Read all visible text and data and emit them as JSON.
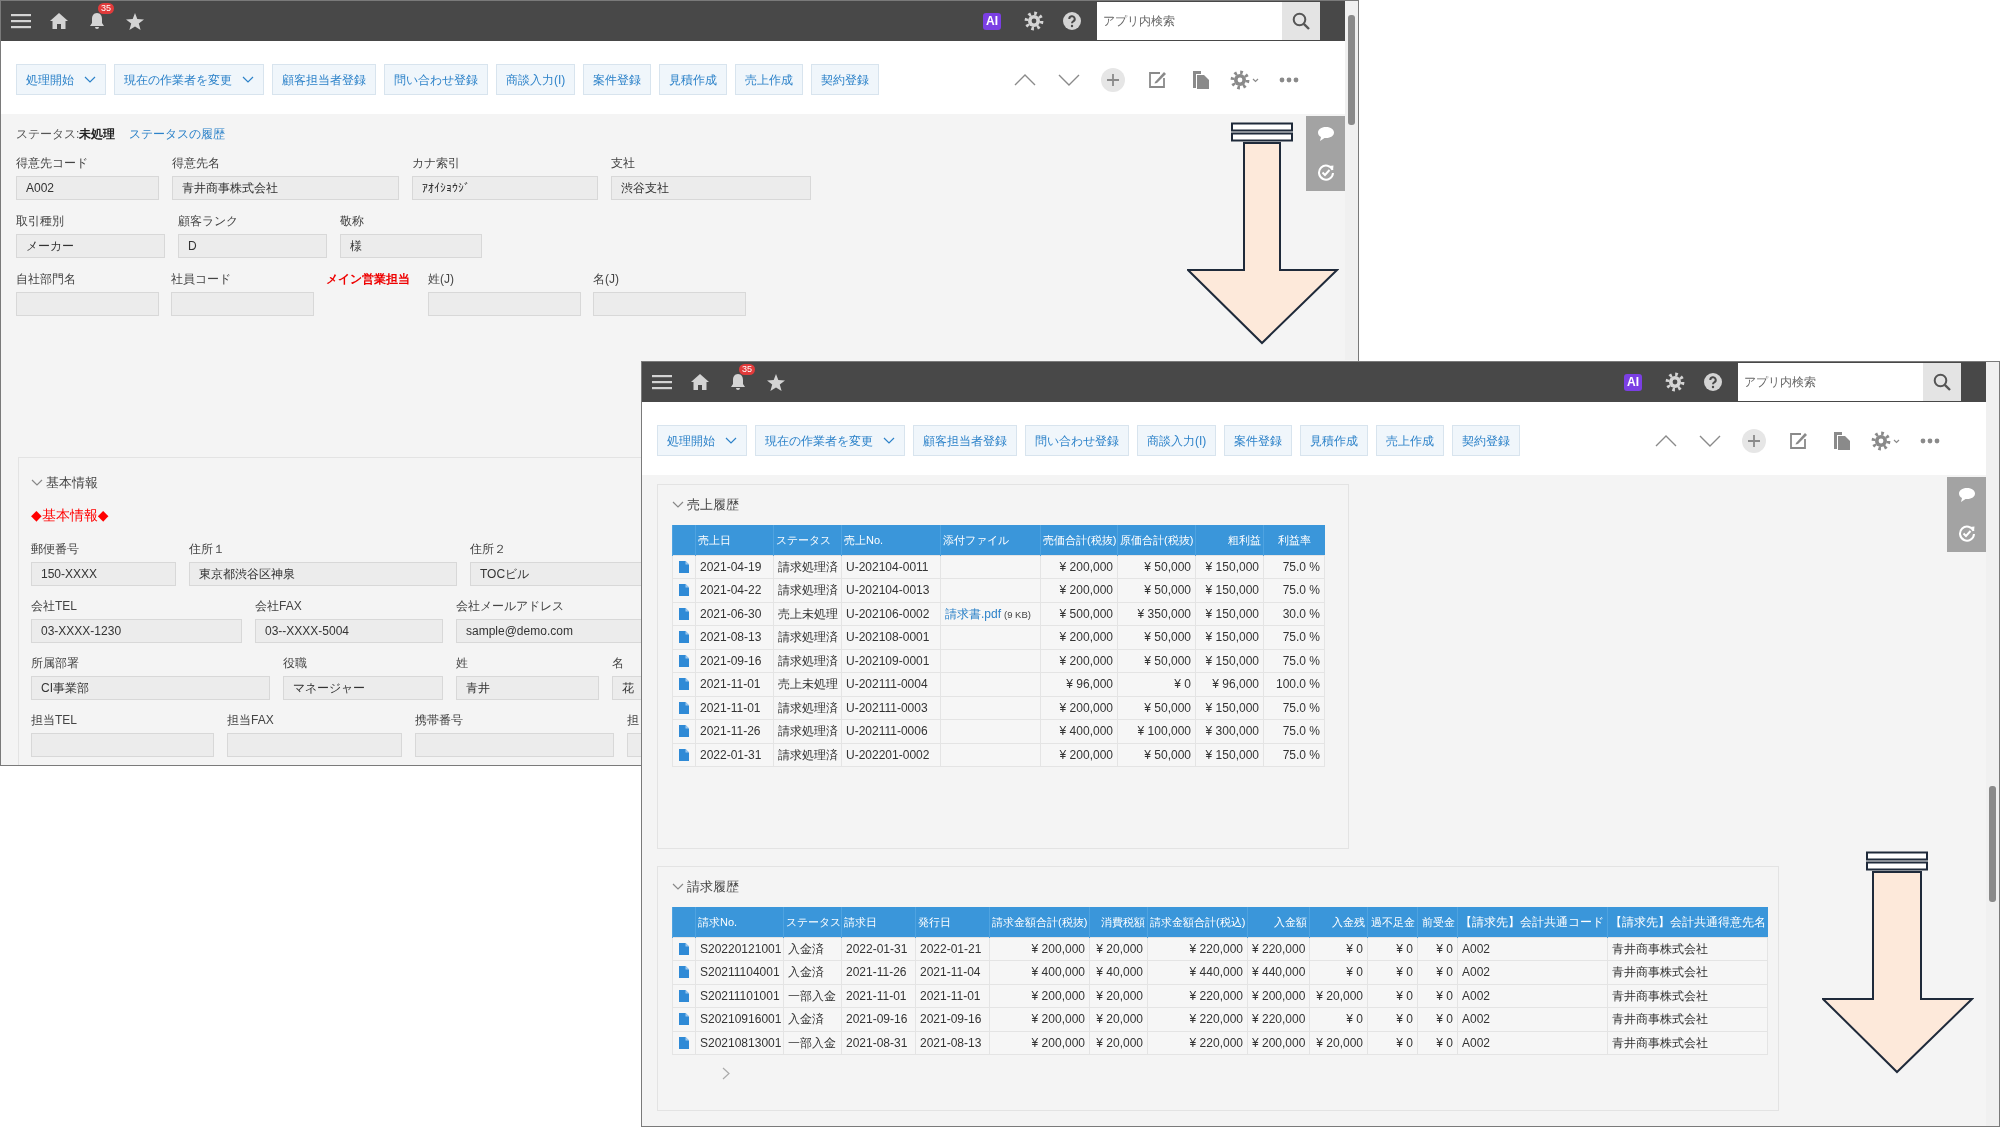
{
  "windows": [
    {
      "toolbar": {
        "notification_count": "35",
        "ai_label": "AI",
        "search_placeholder": "アプリ内検索"
      },
      "actions": [
        {
          "label": "処理開始",
          "dropdown": true
        },
        {
          "label": "現在の作業者を変更",
          "dropdown": true
        },
        {
          "label": "顧客担当者登録",
          "dropdown": false
        },
        {
          "label": "問い合わせ登録",
          "dropdown": false
        },
        {
          "label": "商談入力(I)",
          "dropdown": false
        },
        {
          "label": "案件登録",
          "dropdown": false
        },
        {
          "label": "見積作成",
          "dropdown": false
        },
        {
          "label": "売上作成",
          "dropdown": false
        },
        {
          "label": "契約登録",
          "dropdown": false
        }
      ],
      "status": {
        "label": "ステータス:",
        "value": "未処理",
        "link": "ステータスの履歴"
      },
      "form_rows": [
        [
          {
            "kind": "field",
            "label": "得意先コード",
            "value": "A002"
          },
          {
            "kind": "field",
            "label": "得意先名",
            "value": "青井商事株式会社"
          },
          {
            "kind": "field",
            "label": "カナ索引",
            "value": "ｱｵｲｼｮｳｼﾞ"
          },
          {
            "kind": "field",
            "label": "支社",
            "value": "渋谷支社"
          }
        ],
        [
          {
            "kind": "field",
            "label": "取引種別",
            "value": "メーカー"
          },
          {
            "kind": "field",
            "label": "顧客ランク",
            "value": "D"
          },
          {
            "kind": "field",
            "label": "敬称",
            "value": "様"
          }
        ],
        [
          {
            "kind": "field",
            "label": "自社部門名"
          },
          {
            "kind": "field",
            "label": "社員コード"
          },
          {
            "kind": "heading",
            "label": "メイン営業担当"
          },
          {
            "kind": "field",
            "label": "姓(J)"
          },
          {
            "kind": "field",
            "label": "名(J)"
          }
        ]
      ],
      "section": {
        "title": "基本情報",
        "expanded": true,
        "heading": "◆基本情報◆",
        "rows": [
          [
            {
              "label": "郵便番号",
              "value": "150-XXXX"
            },
            {
              "label": "住所１",
              "value": "東京都渋谷区神泉"
            },
            {
              "label": "住所２",
              "value": "TOCビル"
            }
          ],
          [
            {
              "label": "会社TEL",
              "value": "03-XXXX-1230"
            },
            {
              "label": "会社FAX",
              "value": "03--XXXX-5004"
            },
            {
              "label": "会社メールアドレス",
              "value": "sample@demo.com"
            }
          ],
          [
            {
              "label": "所属部署",
              "value": "CI事業部"
            },
            {
              "label": "役職",
              "value": "マネージャー"
            },
            {
              "label": "姓",
              "value": "青井"
            },
            {
              "label": "名",
              "value": "花"
            }
          ],
          [
            {
              "label": "担当TEL"
            },
            {
              "label": "担当FAX"
            },
            {
              "label": "携帯番号"
            },
            {
              "label": "担"
            }
          ]
        ]
      }
    },
    {
      "toolbar": {
        "notification_count": "35",
        "ai_label": "AI",
        "search_placeholder": "アプリ内検索"
      },
      "actions": [
        {
          "label": "処理開始",
          "dropdown": true
        },
        {
          "label": "現在の作業者を変更",
          "dropdown": true
        },
        {
          "label": "顧客担当者登録",
          "dropdown": false
        },
        {
          "label": "問い合わせ登録",
          "dropdown": false
        },
        {
          "label": "商談入力(I)",
          "dropdown": false
        },
        {
          "label": "案件登録",
          "dropdown": false
        },
        {
          "label": "見積作成",
          "dropdown": false
        },
        {
          "label": "売上作成",
          "dropdown": false
        },
        {
          "label": "契約登録",
          "dropdown": false
        }
      ],
      "sales_history": {
        "title": "売上履歴",
        "expanded": true,
        "columns": [
          "売上日",
          "ステータス",
          "売上No.",
          "添付ファイル",
          "売価合計(税抜)",
          "原価合計(税抜)",
          "粗利益",
          "利益率"
        ],
        "rows": [
          {
            "cells": [
              "2021-04-19",
              "請求処理済",
              "U-202104-0011",
              "",
              "¥ 200,000",
              "¥ 50,000",
              "¥ 150,000",
              "75.0 %"
            ]
          },
          {
            "cells": [
              "2021-04-22",
              "請求処理済",
              "U-202104-0013",
              "",
              "¥ 200,000",
              "¥ 50,000",
              "¥ 150,000",
              "75.0 %"
            ]
          },
          {
            "cells": [
              "2021-06-30",
              "売上未処理",
              "U-202106-0002",
              {
                "file": "請求書.pdf",
                "size": "(9 KB)"
              },
              "¥ 500,000",
              "¥ 350,000",
              "¥ 150,000",
              "30.0 %"
            ]
          },
          {
            "cells": [
              "2021-08-13",
              "請求処理済",
              "U-202108-0001",
              "",
              "¥ 200,000",
              "¥ 50,000",
              "¥ 150,000",
              "75.0 %"
            ]
          },
          {
            "cells": [
              "2021-09-16",
              "請求処理済",
              "U-202109-0001",
              "",
              "¥ 200,000",
              "¥ 50,000",
              "¥ 150,000",
              "75.0 %"
            ]
          },
          {
            "cells": [
              "2021-11-01",
              "売上未処理",
              "U-202111-0004",
              "",
              "¥ 96,000",
              "¥ 0",
              "¥ 96,000",
              "100.0 %"
            ]
          },
          {
            "cells": [
              "2021-11-01",
              "請求処理済",
              "U-202111-0003",
              "",
              "¥ 200,000",
              "¥ 50,000",
              "¥ 150,000",
              "75.0 %"
            ]
          },
          {
            "cells": [
              "2021-11-26",
              "請求処理済",
              "U-202111-0006",
              "",
              "¥ 400,000",
              "¥ 100,000",
              "¥ 300,000",
              "75.0 %"
            ]
          },
          {
            "cells": [
              "2022-01-31",
              "請求処理済",
              "U-202201-0002",
              "",
              "¥ 200,000",
              "¥ 50,000",
              "¥ 150,000",
              "75.0 %"
            ]
          }
        ]
      },
      "billing_history": {
        "title": "請求履歴",
        "expanded": true,
        "columns": [
          "請求No.",
          "ステータス",
          "請求日",
          "発行日",
          "請求金額合計(税抜)",
          "消費税額",
          "請求金額合計(税込)",
          "入金額",
          "入金残",
          "過不足金",
          "前受金",
          "【請求先】会計共通コード",
          "【請求先】会計共通得意先名"
        ],
        "rows": [
          {
            "cells": [
              "S20220121001",
              "入金済",
              "2022-01-31",
              "2022-01-21",
              "¥ 200,000",
              "¥ 20,000",
              "¥ 220,000",
              "¥ 220,000",
              "¥ 0",
              "¥ 0",
              "¥ 0",
              "A002",
              "青井商事株式会社"
            ]
          },
          {
            "cells": [
              "S20211104001",
              "入金済",
              "2021-11-26",
              "2021-11-04",
              "¥ 400,000",
              "¥ 40,000",
              "¥ 440,000",
              "¥ 440,000",
              "¥ 0",
              "¥ 0",
              "¥ 0",
              "A002",
              "青井商事株式会社"
            ]
          },
          {
            "cells": [
              "S20211101001",
              "一部入金",
              "2021-11-01",
              "2021-11-01",
              "¥ 200,000",
              "¥ 20,000",
              "¥ 220,000",
              "¥ 200,000",
              "¥ 20,000",
              "¥ 0",
              "¥ 0",
              "A002",
              "青井商事株式会社"
            ]
          },
          {
            "cells": [
              "S20210916001",
              "入金済",
              "2021-09-16",
              "2021-09-16",
              "¥ 200,000",
              "¥ 20,000",
              "¥ 220,000",
              "¥ 220,000",
              "¥ 0",
              "¥ 0",
              "¥ 0",
              "A002",
              "青井商事株式会社"
            ]
          },
          {
            "cells": [
              "S20210813001",
              "一部入金",
              "2021-08-31",
              "2021-08-13",
              "¥ 200,000",
              "¥ 20,000",
              "¥ 220,000",
              "¥ 200,000",
              "¥ 20,000",
              "¥ 0",
              "¥ 0",
              "A002",
              "青井商事株式会社"
            ]
          }
        ]
      }
    }
  ]
}
